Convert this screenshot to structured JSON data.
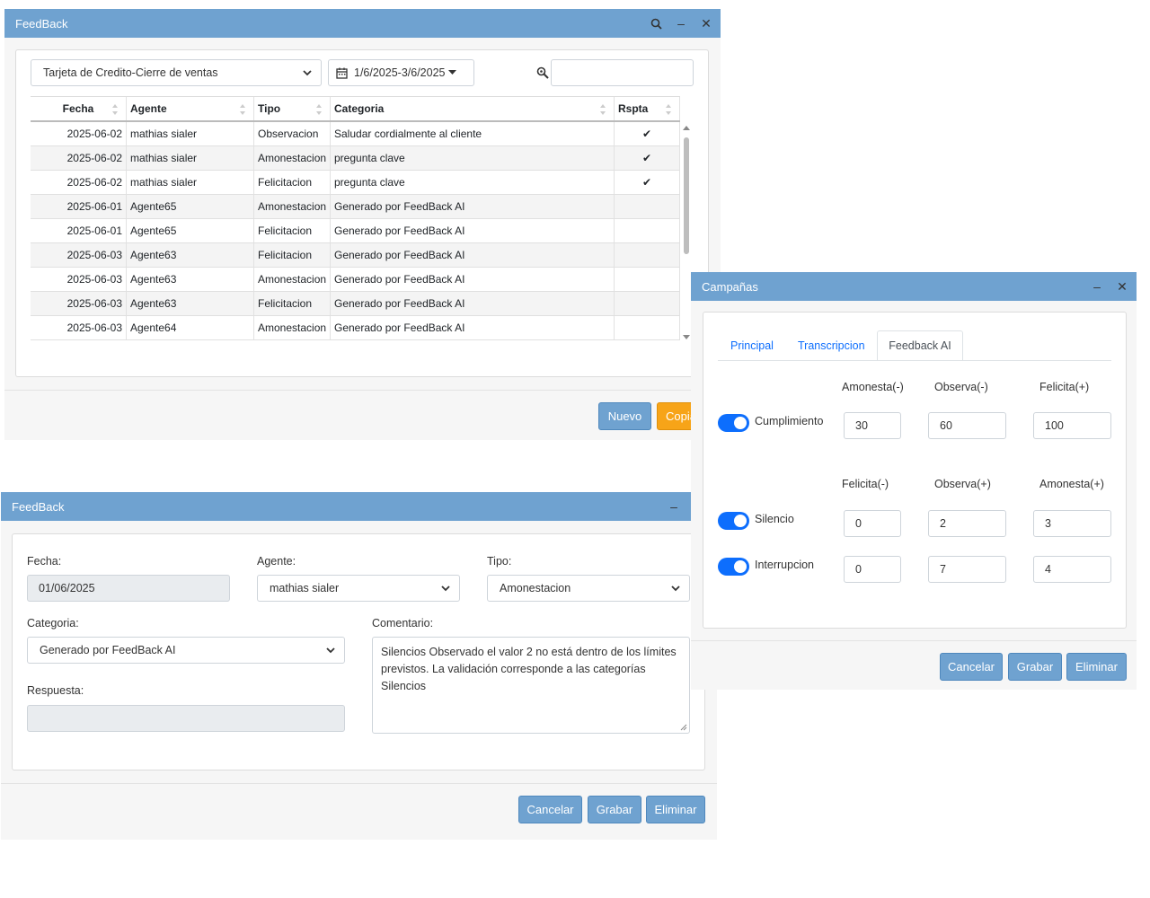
{
  "main_window": {
    "title": "FeedBack",
    "filter_select": "Tarjeta de Credito-Cierre de ventas",
    "date_range": "1/6/2025-3/6/2025",
    "search_value": "",
    "columns": [
      "Fecha",
      "Agente",
      "Tipo",
      "Categoria",
      "Rspta"
    ],
    "rows": [
      {
        "fecha": "2025-06-02",
        "agente": "mathias sialer",
        "tipo": "Observacion",
        "categoria": "Saludar cordialmente al cliente",
        "rspta": "✔"
      },
      {
        "fecha": "2025-06-02",
        "agente": "mathias sialer",
        "tipo": "Amonestacion",
        "categoria": "pregunta clave",
        "rspta": "✔"
      },
      {
        "fecha": "2025-06-02",
        "agente": "mathias sialer",
        "tipo": "Felicitacion",
        "categoria": "pregunta clave",
        "rspta": "✔"
      },
      {
        "fecha": "2025-06-01",
        "agente": "Agente65",
        "tipo": "Amonestacion",
        "categoria": "Generado por FeedBack AI",
        "rspta": ""
      },
      {
        "fecha": "2025-06-01",
        "agente": "Agente65",
        "tipo": "Felicitacion",
        "categoria": "Generado por FeedBack AI",
        "rspta": ""
      },
      {
        "fecha": "2025-06-03",
        "agente": "Agente63",
        "tipo": "Felicitacion",
        "categoria": "Generado por FeedBack AI",
        "rspta": ""
      },
      {
        "fecha": "2025-06-03",
        "agente": "Agente63",
        "tipo": "Amonestacion",
        "categoria": "Generado por FeedBack AI",
        "rspta": ""
      },
      {
        "fecha": "2025-06-03",
        "agente": "Agente63",
        "tipo": "Felicitacion",
        "categoria": "Generado por FeedBack AI",
        "rspta": ""
      },
      {
        "fecha": "2025-06-03",
        "agente": "Agente64",
        "tipo": "Amonestacion",
        "categoria": "Generado por FeedBack AI",
        "rspta": ""
      }
    ],
    "buttons": {
      "nuevo": "Nuevo",
      "copiar": "Copiar"
    }
  },
  "edit_window": {
    "title": "FeedBack",
    "fecha_label": "Fecha:",
    "fecha_value": "01/06/2025",
    "agente_label": "Agente:",
    "agente_value": "mathias sialer",
    "tipo_label": "Tipo:",
    "tipo_value": "Amonestacion",
    "categoria_label": "Categoria:",
    "categoria_value": "Generado por FeedBack AI",
    "comentario_label": "Comentario:",
    "comentario_value": "Silencios Observado el valor 2 no está dentro de los límites previstos. La validación corresponde a las categorías Silencios",
    "respuesta_label": "Respuesta:",
    "respuesta_value": "",
    "buttons": {
      "cancelar": "Cancelar",
      "grabar": "Grabar",
      "eliminar": "Eliminar"
    }
  },
  "campaign_window": {
    "title": "Campañas",
    "tabs": [
      "Principal",
      "Transcripcion",
      "Feedback AI"
    ],
    "active_tab": "Feedback AI",
    "group1_headers": [
      "Amonesta(-)",
      "Observa(-)",
      "Felicita(+)"
    ],
    "group2_headers": [
      "Felicita(-)",
      "Observa(+)",
      "Amonesta(+)"
    ],
    "rows": [
      {
        "label": "Cumplimiento",
        "enabled": true,
        "values": [
          "30",
          "60",
          "100"
        ]
      },
      {
        "label": "Silencio",
        "enabled": true,
        "values": [
          "0",
          "2",
          "3"
        ]
      },
      {
        "label": "Interrupcion",
        "enabled": true,
        "values": [
          "0",
          "7",
          "4"
        ]
      }
    ],
    "buttons": {
      "cancelar": "Cancelar",
      "grabar": "Grabar",
      "eliminar": "Eliminar"
    }
  },
  "colors": {
    "titlebar": "#6fa2d0",
    "primary_button": "#6fa2d0",
    "accent_orange": "#f7a418",
    "toggle": "#0d6efd"
  }
}
